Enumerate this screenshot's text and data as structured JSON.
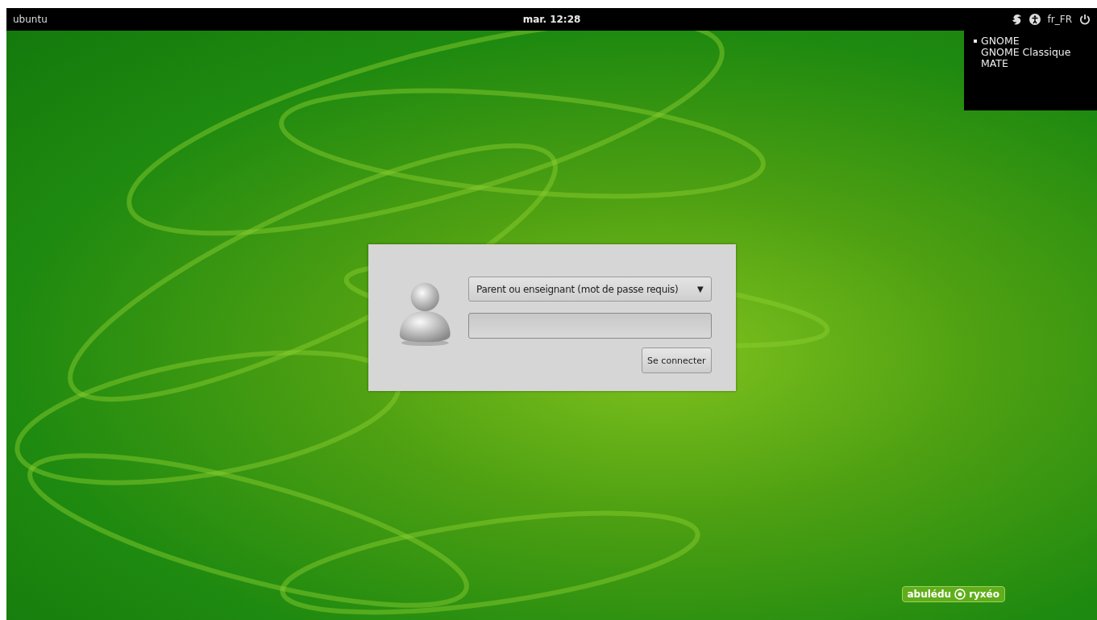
{
  "top_bar": {
    "hostname": "ubuntu",
    "clock": "mar. 12:28",
    "keyboard_layout": "fr_FR"
  },
  "session_menu": {
    "items": [
      {
        "label": "GNOME",
        "selected": true
      },
      {
        "label": "GNOME Classique",
        "selected": false
      },
      {
        "label": "MATE",
        "selected": false
      }
    ]
  },
  "login": {
    "user_select": {
      "value": "Parent ou enseignant (mot de passe requis)",
      "arrow": "▼"
    },
    "button": "Se connecter"
  },
  "logo": {
    "left": "abulédu",
    "right": "ryxéo"
  }
}
